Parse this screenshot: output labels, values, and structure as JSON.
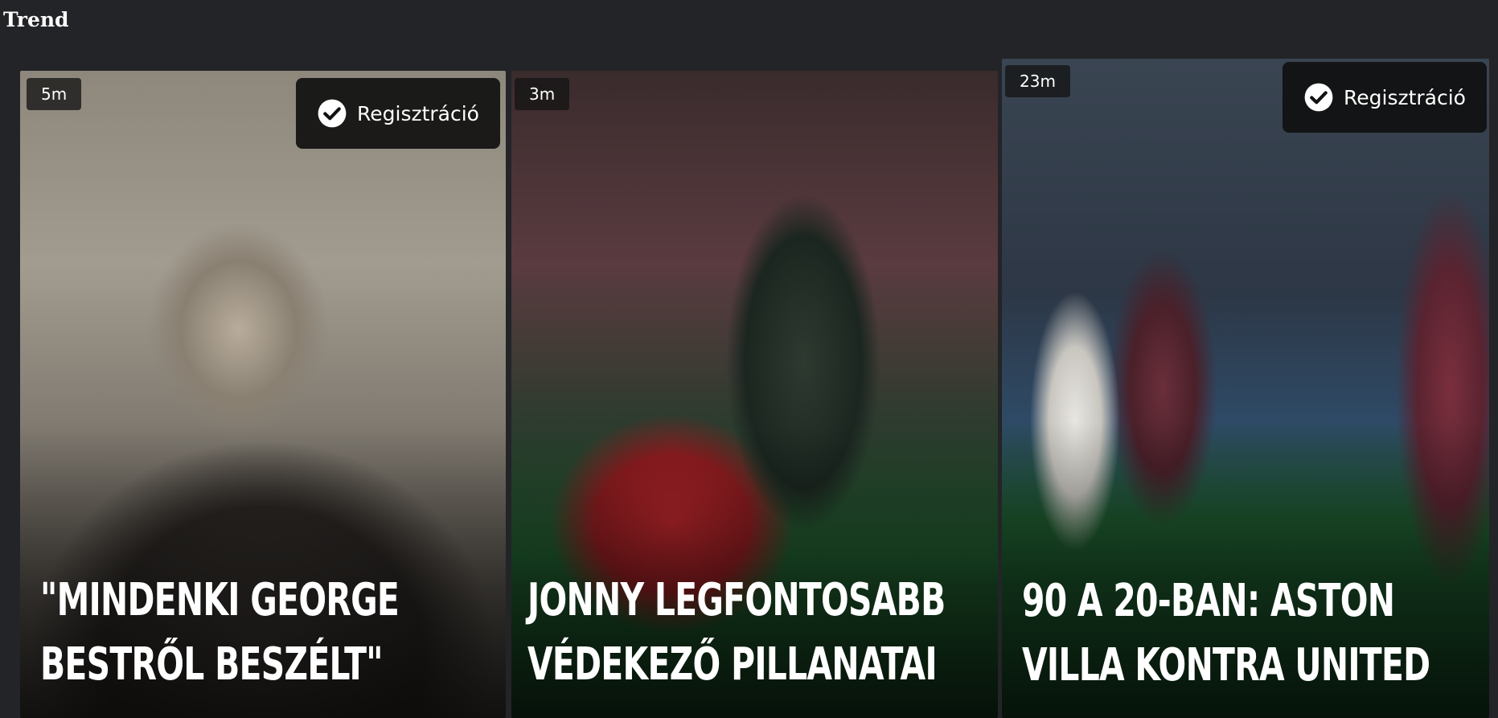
{
  "section": {
    "title": "Trend"
  },
  "cards": [
    {
      "time": "5m",
      "show_register": true,
      "register_label": "Regisztráció",
      "headline_lines": [
        "\"MINDENKI GEORGE",
        "BESTRŐL BESZÉLT\""
      ]
    },
    {
      "time": "3m",
      "show_register": false,
      "register_label": "",
      "headline_lines": [
        "JONNY LEGFONTOSABB",
        "VÉDEKEZŐ PILLANATAI"
      ]
    },
    {
      "time": "23m",
      "show_register": true,
      "register_label": "Regisztráció",
      "headline_lines": [
        "90 A 20-BAN: ASTON",
        "VILLA KONTRA UNITED"
      ]
    }
  ],
  "icons": {
    "register": "check-circle-icon"
  }
}
